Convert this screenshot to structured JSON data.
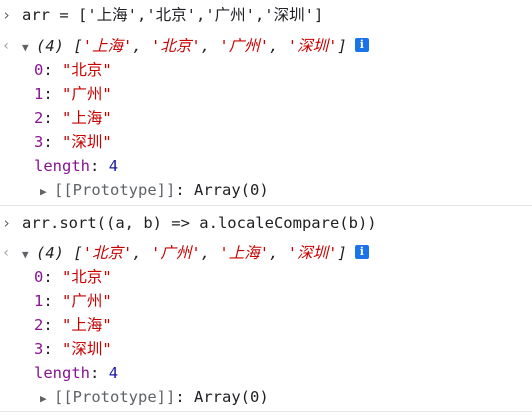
{
  "console": {
    "entries": [
      {
        "input": "arr = ['上海','北京','广州','深圳']",
        "summary_count": "(4)",
        "summary_items": [
          "'上海'",
          "'北京'",
          "'广州'",
          "'深圳'"
        ],
        "items": [
          {
            "index": "0",
            "value": "\"北京\""
          },
          {
            "index": "1",
            "value": "\"广州\""
          },
          {
            "index": "2",
            "value": "\"上海\""
          },
          {
            "index": "3",
            "value": "\"深圳\""
          }
        ],
        "length_key": "length",
        "length_value": "4",
        "prototype_key": "[[Prototype]]",
        "prototype_value": "Array(0)"
      },
      {
        "input": "arr.sort((a, b) => a.localeCompare(b))",
        "summary_count": "(4)",
        "summary_items": [
          "'北京'",
          "'广州'",
          "'上海'",
          "'深圳'"
        ],
        "items": [
          {
            "index": "0",
            "value": "\"北京\""
          },
          {
            "index": "1",
            "value": "\"广州\""
          },
          {
            "index": "2",
            "value": "\"上海\""
          },
          {
            "index": "3",
            "value": "\"深圳\""
          }
        ],
        "length_key": "length",
        "length_value": "4",
        "prototype_key": "[[Prototype]]",
        "prototype_value": "Array(0)"
      }
    ]
  },
  "icons": {
    "input_prompt": "chevron-right-icon",
    "output_prompt": "chevron-left-icon",
    "expand": "triangle-down-icon",
    "collapse": "triangle-right-icon",
    "info": "info-icon"
  },
  "glyphs": {
    "input_prompt": "›",
    "output_prompt": "‹",
    "expanded": "▼",
    "collapsed": "▶",
    "info": "i",
    "colon": ":",
    "comma": ",",
    "open_bracket": "[",
    "close_bracket": "]"
  },
  "colors": {
    "string": "#c80000",
    "key": "#881391",
    "number": "#1a1aa6",
    "info_badge": "#1a73e8",
    "separator": "#e6e6e6"
  }
}
